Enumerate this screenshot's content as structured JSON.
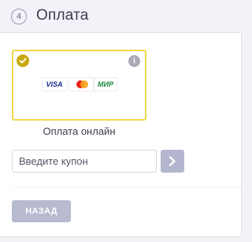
{
  "header": {
    "step_number": "4",
    "title": "Оплата"
  },
  "payment_option": {
    "label": "Оплата онлайн",
    "selected": true,
    "logos": {
      "visa": "VISA",
      "mir": "МИР"
    },
    "icons": {
      "check": "check-circle-icon",
      "info": "info-icon",
      "mastercard": "mastercard-logo"
    },
    "colors": {
      "selected_border": "#f0d84a",
      "check": "#c9a90e"
    }
  },
  "coupon": {
    "placeholder": "Введите купон",
    "value": "",
    "submit_icon": "chevron-right-icon"
  },
  "actions": {
    "back_label": "НАЗАД"
  }
}
